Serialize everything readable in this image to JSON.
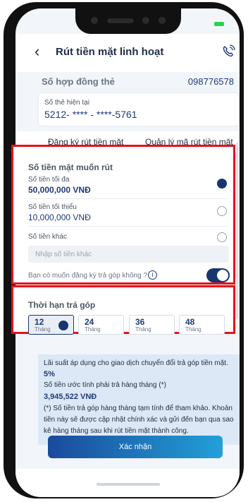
{
  "header": {
    "title": "Rút tiền mặt linh hoạt",
    "back_icon": "chevron-left-icon",
    "phone_icon": "phone-call-icon"
  },
  "contract": {
    "label": "Số hợp đồng thẻ",
    "value": "098776578"
  },
  "current_card": {
    "label": "Số thẻ hiện tại",
    "value": "5212- **** - ****-5761"
  },
  "tabs": [
    {
      "label": "Đăng ký rút tiền mặt",
      "active": true
    },
    {
      "label": "Quản lý mã rút tiền mặt",
      "active": false
    }
  ],
  "amount_section": {
    "title": "Số tiền mặt muốn rút",
    "options": [
      {
        "label": "Số tiền tối đa",
        "value": "50,000,000 VNĐ",
        "selected": true
      },
      {
        "label": "Số tiền tối thiểu",
        "value": "10,000,000 VNĐ",
        "selected": false
      },
      {
        "label": "Số tiền khác",
        "selected": false
      }
    ],
    "other_placeholder": "Nhập số tiền khác",
    "installment_question": "Bạn có muốn đăng ký trả góp không ?",
    "info_glyph": "i",
    "installment_toggle_on": true
  },
  "term_section": {
    "title": "Thời hạn trả góp",
    "terms": [
      {
        "num": "12",
        "unit": "Tháng",
        "selected": true
      },
      {
        "num": "24",
        "unit": "Tháng",
        "selected": false
      },
      {
        "num": "36",
        "unit": "Tháng",
        "selected": false
      },
      {
        "num": "48",
        "unit": "Tháng",
        "selected": false
      }
    ]
  },
  "info": {
    "rate_text": "Lãi suất áp dụng cho giao dịch chuyển đổi trả góp tiền mặt.",
    "rate_value": "5%",
    "monthly_text": "Số tiền ước tính phải trả hàng tháng (*)",
    "monthly_value": "3,945,522 VNĐ",
    "note": "(*) Số tiền trả góp hàng tháng tạm tính để tham khảo. Khoản tiền này sẽ được cập nhật chính xác và gửi đến bạn qua sao kê hàng tháng sau khi rút tiền mặt thành công."
  },
  "confirm_label": "Xác nhận",
  "colors": {
    "primary": "#17366e",
    "highlight": "#e2141a",
    "info_bg": "#dde8f6"
  }
}
